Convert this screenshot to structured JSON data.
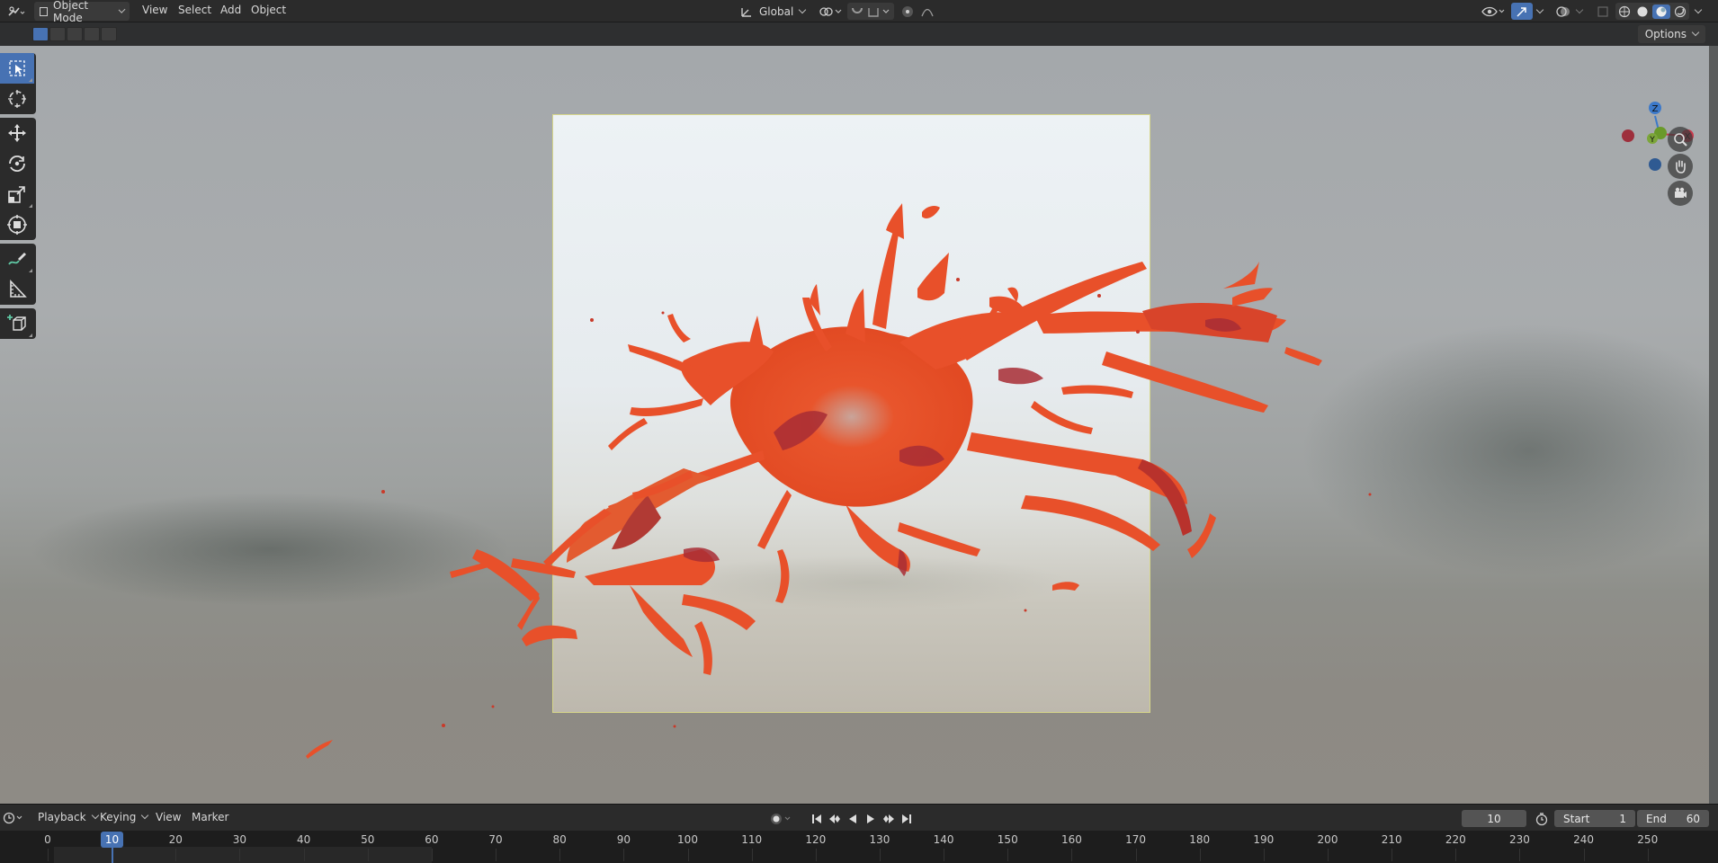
{
  "header": {
    "mode": "Object Mode",
    "menus": [
      "View",
      "Select",
      "Add",
      "Object"
    ],
    "transform_orientation": "Global"
  },
  "subheader": {
    "options_label": "Options"
  },
  "gizmo": {
    "x": "X",
    "y": "Y",
    "z": "Z"
  },
  "timeline": {
    "menus": [
      "Playback",
      "Keying",
      "View",
      "Marker"
    ],
    "current_frame": "10",
    "start_label": "Start",
    "start_value": "1",
    "end_label": "End",
    "end_value": "60",
    "ruler": [
      "0",
      "10",
      "20",
      "30",
      "40",
      "50",
      "60",
      "70",
      "80",
      "90",
      "100",
      "110",
      "120",
      "130",
      "140",
      "150",
      "160",
      "170",
      "180",
      "190",
      "200",
      "210",
      "220",
      "230",
      "240",
      "250"
    ]
  },
  "colors": {
    "accent": "#4772b3",
    "splash": "#e8502a",
    "axis_x": "#c9374a",
    "axis_y": "#6a9a2a",
    "axis_z": "#3c79c9"
  }
}
